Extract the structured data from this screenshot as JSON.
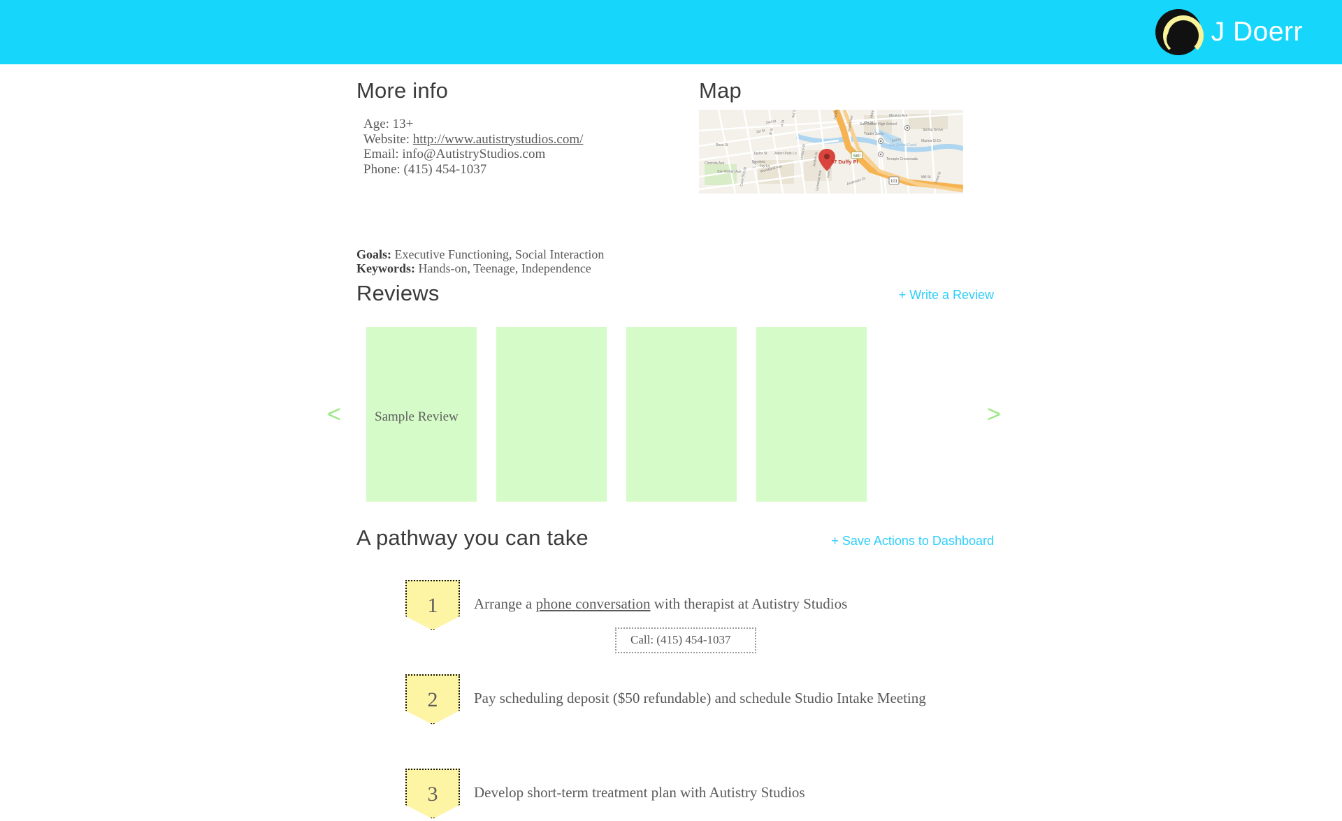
{
  "header": {
    "username": "J Doerr",
    "avatar_icon": "user-avatar-icon",
    "background_color": "#16d7fb"
  },
  "more_info": {
    "heading": "More info",
    "age_line": "Age: 13+",
    "website_label": "Website: ",
    "website_url": "http://www.autistrystudios.com/",
    "email_line": "Email: info@AutistryStudios.com",
    "phone_line": "Phone: (415) 454-1037",
    "goals_label": "Goals:",
    "goals_value": " Executive Functioning, Social Interaction",
    "keywords_label": "Keywords:",
    "keywords_value": " Hands-on, Teenage, Independence"
  },
  "map": {
    "heading": "Map",
    "marker_label": "37 Duffy Pl",
    "labels": [
      "2nd St",
      "3rd St",
      "1st St",
      "A St",
      "B St",
      "4th St",
      "San Rafael High School",
      "Trader Joe's",
      "San Rafael Creek",
      "Ross St",
      "Taylor St",
      "Albert Park Ln",
      "Lincoln Ave",
      "Clorinda Ave",
      "San Rafael Ave",
      "Irwin St",
      "Andersen Dr",
      "Mission Ave",
      "Grand Ave",
      "Terrapin Crossroads",
      "Mill St",
      "Francisco Blvd",
      "Bayview",
      "Ivy Ln",
      "Woodland Ave",
      "Jordan St",
      "Lindaro St",
      "D St",
      "C St",
      "Mary St",
      "Marina Ct Dr",
      "Front St",
      "Spring Grove",
      "Heatherton St",
      "Lynwood Ave",
      "Cove St",
      "101",
      "580"
    ]
  },
  "reviews": {
    "heading": "Reviews",
    "write_review_label": "+  Write a Review",
    "prev_arrow": "<",
    "next_arrow": ">",
    "cards": [
      {
        "text": "Sample Review"
      },
      {
        "text": ""
      },
      {
        "text": ""
      },
      {
        "text": ""
      }
    ]
  },
  "pathway": {
    "heading": "A pathway you can take",
    "save_actions_label": "+ Save Actions to Dashboard",
    "steps": [
      {
        "number": "1",
        "text_before": "Arrange a ",
        "link_text": "phone conversation",
        "text_after": " with therapist at Autistry Studios"
      },
      {
        "number": "2",
        "text_before": "Pay scheduling deposit ($50 refundable) and schedule Studio Intake Meeting",
        "link_text": "",
        "text_after": ""
      },
      {
        "number": "3",
        "text_before": "Develop short-term treatment plan with Autistry Studios",
        "link_text": "",
        "text_after": ""
      }
    ],
    "tooltip": "Call: (415) 454-1037"
  },
  "colors": {
    "accent_cyan": "#2ecefb",
    "header_cyan": "#16d7fb",
    "review_green": "#d5fbc8",
    "arrow_green": "#9ae884",
    "badge_yellow": "#fdf4a4"
  }
}
